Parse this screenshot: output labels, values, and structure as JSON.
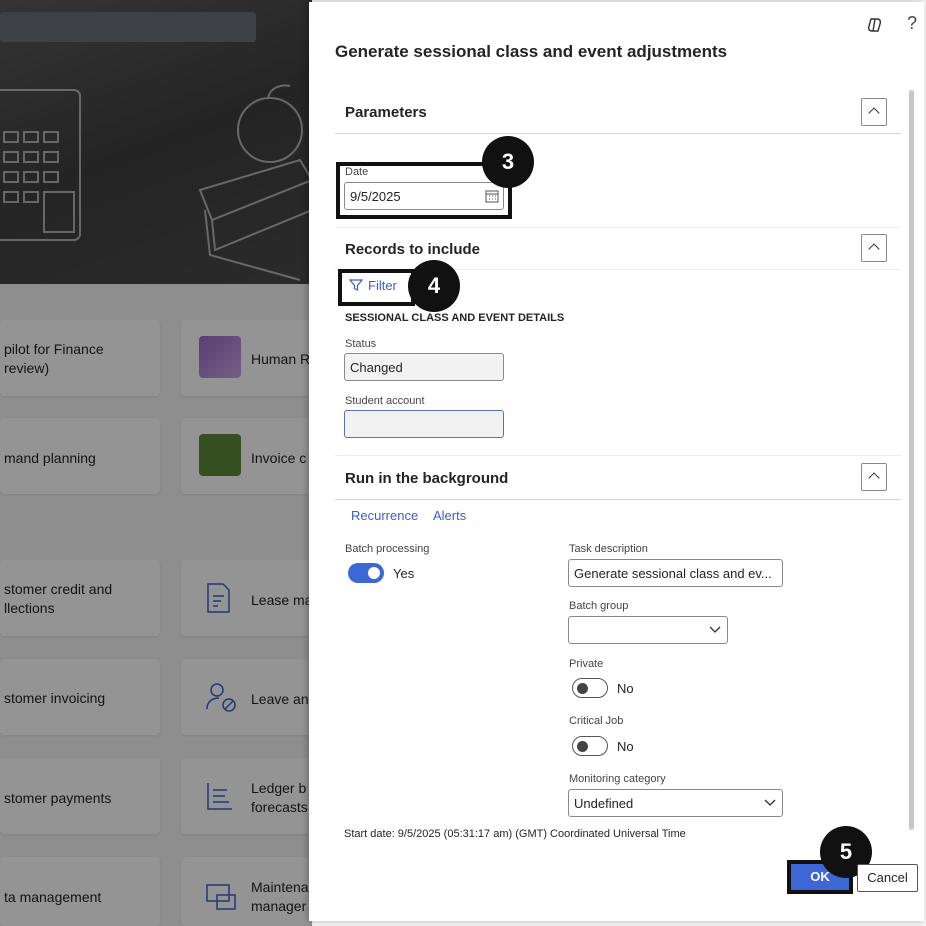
{
  "background": {
    "tiles": [
      {
        "label": "pilot for Finance\nreview)"
      },
      {
        "label": "Human R"
      },
      {
        "label": "mand planning"
      },
      {
        "label": "Invoice c"
      },
      {
        "label": "stomer credit and\nllections"
      },
      {
        "label": "Lease ma"
      },
      {
        "label": "stomer invoicing"
      },
      {
        "label": "Leave and"
      },
      {
        "label": "stomer payments"
      },
      {
        "label": "Ledger b\nforecasts"
      },
      {
        "label": "ta management"
      },
      {
        "label": "Maintena\nmanager"
      }
    ]
  },
  "panel": {
    "title": "Generate sessional class and event adjustments",
    "help_glyph": "?",
    "parameters": {
      "title": "Parameters",
      "date_label": "Date",
      "date_value": "9/5/2025"
    },
    "records": {
      "title": "Records to include",
      "filter_label": "Filter",
      "section_heading": "SESSIONAL CLASS AND EVENT DETAILS",
      "status_label": "Status",
      "status_value": "Changed",
      "student_label": "Student account",
      "student_value": ""
    },
    "background_run": {
      "title": "Run in the background",
      "recurrence_label": "Recurrence",
      "alerts_label": "Alerts",
      "batch_label": "Batch processing",
      "batch_value": "Yes",
      "batch_on": true,
      "task_label": "Task description",
      "task_value": "Generate sessional class and ev...",
      "batch_group_label": "Batch group",
      "batch_group_value": "",
      "private_label": "Private",
      "private_value": "No",
      "critical_label": "Critical Job",
      "critical_value": "No",
      "monitoring_label": "Monitoring category",
      "monitoring_value": "Undefined"
    },
    "start_date_text": "Start date: 9/5/2025 (05:31:17 am) (GMT) Coordinated Universal Time",
    "ok_label": "OK",
    "cancel_label": "Cancel"
  },
  "callouts": {
    "date": "3",
    "filter": "4",
    "ok": "5"
  },
  "colors": {
    "accent": "#3d67d4",
    "link": "#3a5fcd",
    "callout": "#111111"
  }
}
